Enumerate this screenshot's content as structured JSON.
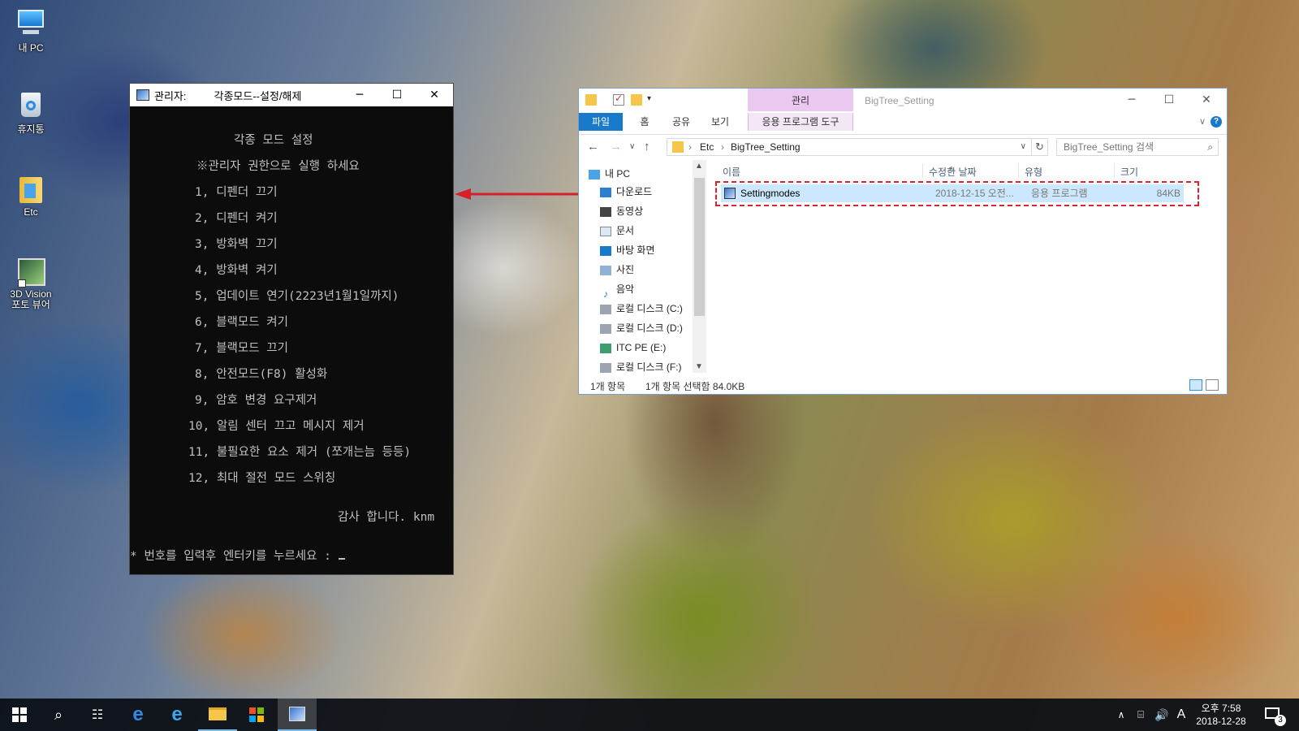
{
  "desktop": {
    "icons": [
      {
        "label": "내 PC",
        "icon": "computer-icon"
      },
      {
        "label": "휴지통",
        "icon": "recycle-bin-icon"
      },
      {
        "label": "Etc",
        "icon": "folder-icon"
      },
      {
        "label": "3D Vision",
        "label2": "포토 뷰어",
        "icon": "3d-vision-photo-viewer-icon"
      }
    ]
  },
  "console": {
    "title_prefix": "관리자:",
    "title": "각종모드--설정/해제",
    "heading": "각종 모드 설정",
    "notice": "※관리자 권한으로 실행 하세요",
    "options": [
      "1, 디펜더 끄기",
      "2, 디펜더 켜기",
      "3, 방화벽 끄기",
      "4, 방화벽 켜기",
      "5, 업데이트 연기(2223년1월1일까지)",
      "6, 블랙모드 켜기",
      "7, 블랙모드 끄기",
      "8, 안전모드(F8) 활성화",
      "9, 암호 변경 요구제거",
      "10, 알림 센터 끄고 메시지 제거",
      "11, 불필요한 요소 제거 (쪼개는늠 등등)",
      "12, 최대 절전 모드 스위칭"
    ],
    "thanks": "감사 합니다. knm",
    "prompt": "* 번호를 입력후 엔터키를 누르세요 :",
    "background": "#0c0c0c",
    "text_color": "#c0c0c0"
  },
  "explorer": {
    "window_title": "BigTree_Setting",
    "context_tab": "관리",
    "ribbon_tabs": [
      "파일",
      "홈",
      "공유",
      "보기",
      "응용 프로그램 도구"
    ],
    "address": [
      "Etc",
      "BigTree_Setting"
    ],
    "search_placeholder": "BigTree_Setting 검색",
    "nav_items": [
      "내 PC",
      "다운로드",
      "동영상",
      "문서",
      "바탕 화면",
      "사진",
      "음악",
      "로컬 디스크 (C:)",
      "로컬 디스크 (D:)",
      "ITC PE (E:)",
      "로컬 디스크 (F:)"
    ],
    "columns": [
      "이름",
      "수정한 날짜",
      "유형",
      "크기"
    ],
    "files": [
      {
        "name": "Settingmodes",
        "modified": "2018-12-15 오전...",
        "type": "응용 프로그램",
        "size": "84KB"
      }
    ],
    "status_count": "1개 항목",
    "status_selected": "1개 항목 선택함 84.0KB",
    "accent": "#1979ca",
    "highlight_color": "#e0202a"
  },
  "taskbar": {
    "apps": [
      "start-icon",
      "search-icon",
      "task-view-icon",
      "edge-icon",
      "internet-explorer-icon",
      "file-explorer-icon",
      "store-icon",
      "settingmodes-icon"
    ],
    "ime": "A",
    "clock_time": "오후 7:58",
    "clock_date": "2018-12-28",
    "notification_count": "3"
  }
}
